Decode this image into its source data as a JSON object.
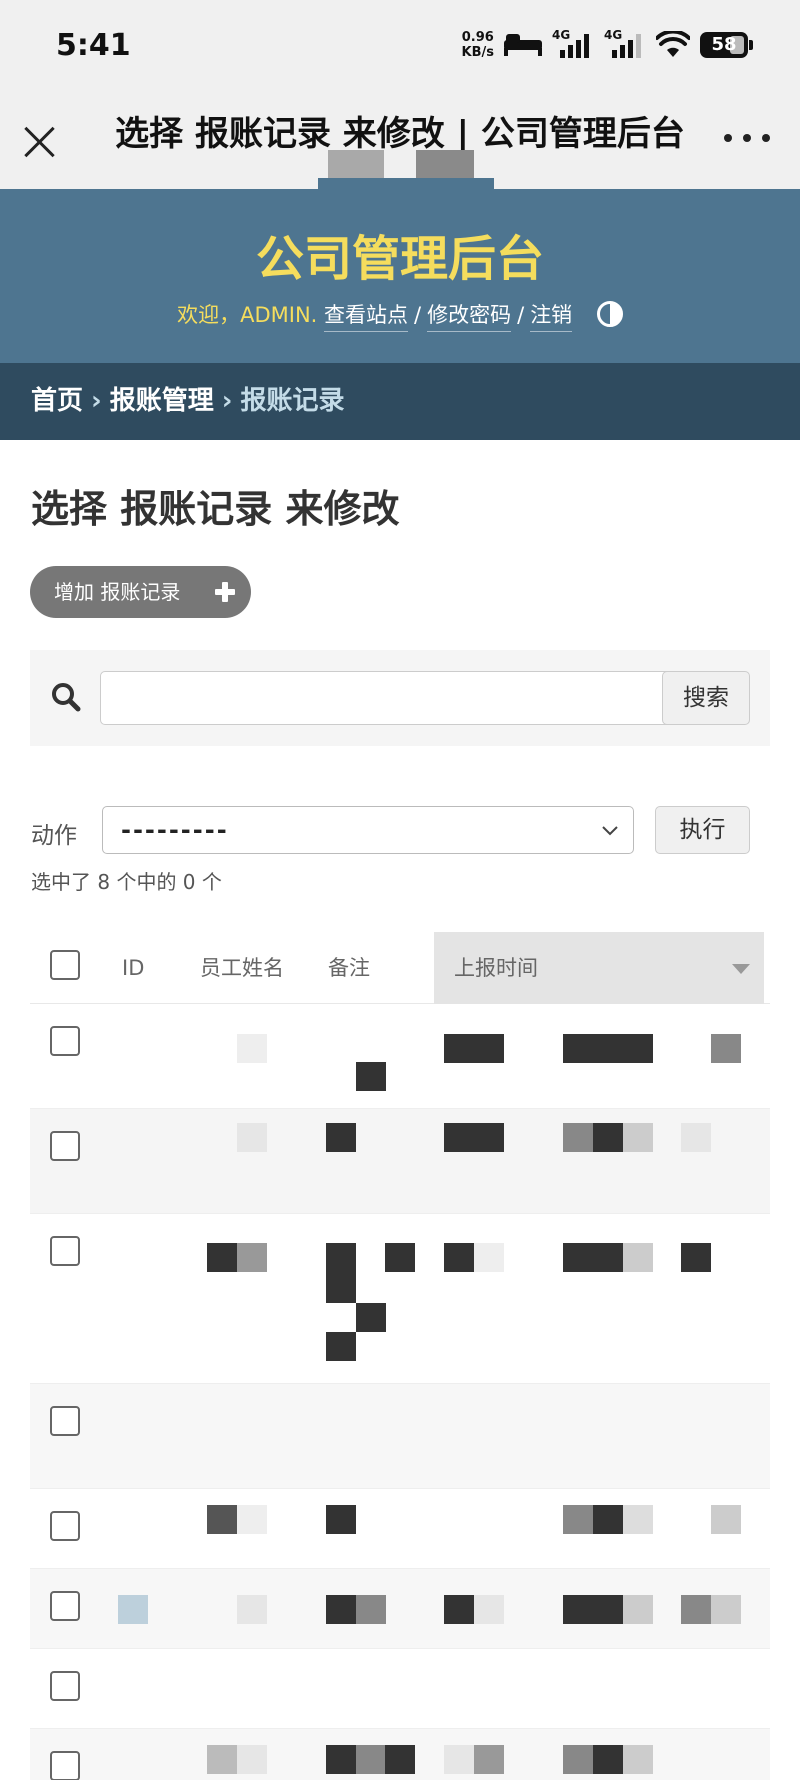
{
  "status_bar": {
    "time": "5:41",
    "net_speed_value": "0.96",
    "net_speed_unit": "KB/s",
    "signal1_label": "4G",
    "signal2_label": "4G",
    "battery": "58",
    "icons": [
      "bed-icon",
      "signal-icon",
      "signal-icon",
      "wifi-icon",
      "battery-icon"
    ]
  },
  "webview_nav": {
    "title": "选择 报账记录 来修改 | 公司管理后台",
    "close_icon": "close-icon",
    "more_icon": "more-icon"
  },
  "header": {
    "site_name": "公司管理后台",
    "welcome": "欢迎，ADMIN.",
    "links": [
      "查看站点",
      "修改密码",
      "注销"
    ],
    "separator": "/",
    "theme_icon": "theme-toggle-icon"
  },
  "breadcrumbs": {
    "items": [
      "首页",
      "报账管理",
      "报账记录"
    ],
    "separator": "›"
  },
  "content": {
    "title": "选择 报账记录 来修改",
    "add_button": "增加 报账记录",
    "search": {
      "value": "",
      "placeholder": "",
      "button": "搜索"
    },
    "actions": {
      "label": "动作",
      "selected": "---------",
      "run_button": "执行",
      "counter": "选中了 8 个中的 0 个"
    }
  },
  "table": {
    "columns": [
      "ID",
      "员工姓名",
      "备注",
      "上报时间"
    ],
    "sorted_column": "上报时间",
    "row_count_visible": 8,
    "rows_note": "row contents are pixelated/redacted in the screenshot"
  },
  "colors": {
    "header_bg": "#4e7590",
    "breadcrumbs_bg": "#2f4b5f",
    "site_name": "#f5dd5d",
    "breadcrumb_current": "#c4dce8"
  }
}
